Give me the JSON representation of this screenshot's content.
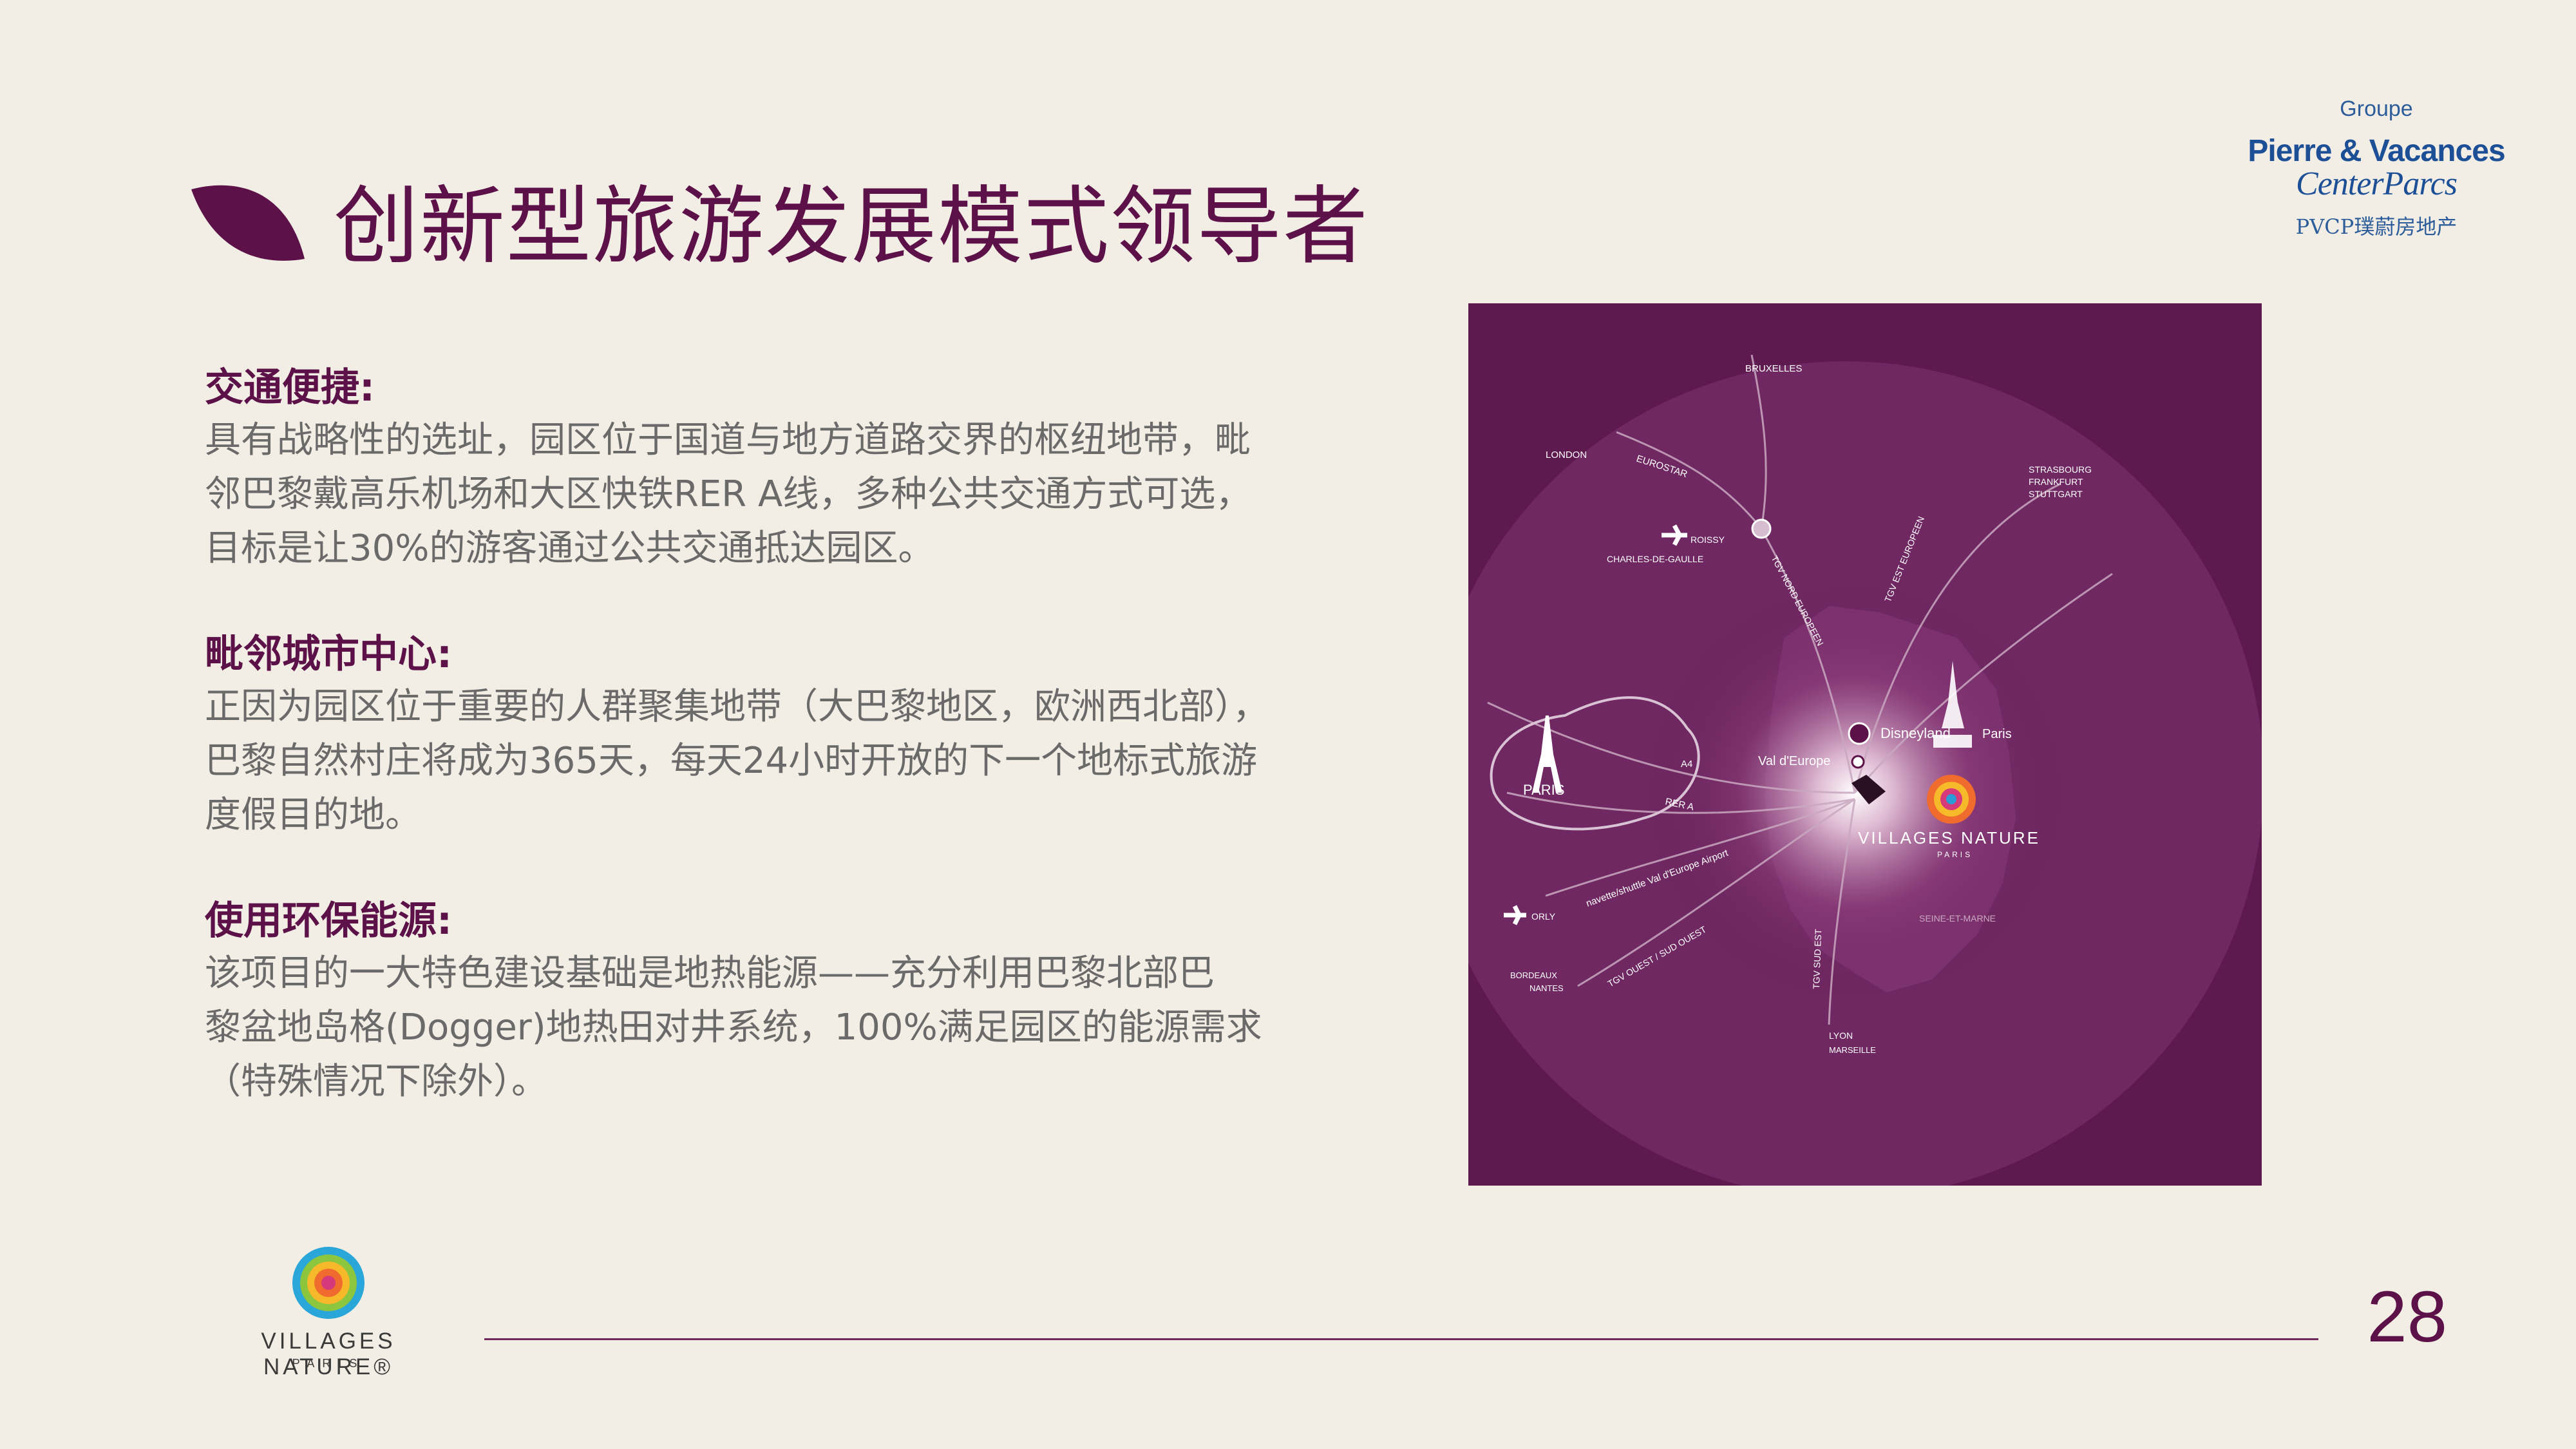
{
  "slide": {
    "title": "创新型旅游发展模式领导者",
    "page_number": "28"
  },
  "brand": {
    "groupe": "Groupe",
    "pierre_vacances": "Pierre & Vacances",
    "center_parcs": "CenterParcs",
    "chinese_name": "PVCP璞蔚房地产"
  },
  "sections": [
    {
      "heading": "交通便捷:",
      "lines": [
        "具有战略性的选址，园区位于国道与地方道路交界的枢纽地带，毗",
        "邻巴黎戴高乐机场和大区快铁RER  A线，多种公共交通方式可选，",
        "目标是让30%的游客通过公共交通抵达园区。"
      ]
    },
    {
      "heading": "毗邻城市中心:",
      "lines": [
        "正因为园区位于重要的人群聚集地带（大巴黎地区，欧洲西北部），",
        "巴黎自然村庄将成为365天，每天24小时开放的下一个地标式旅游",
        "度假目的地。"
      ]
    },
    {
      "heading": "使用环保能源:",
      "lines": [
        "该项目的一大特色建设基础是地热能源——充分利用巴黎北部巴",
        "黎盆地岛格(Dogger)地热田对井系统，100%满足园区的能源需求",
        "（特殊情况下除外）。"
      ]
    }
  ],
  "map": {
    "labels": {
      "bruxelles": "BRUXELLES",
      "london": "LONDON",
      "eurostar": "EUROSTAR",
      "strasbourg": "STRASBOURG",
      "frankfurt": "FRANKFURT",
      "stuttgart": "STUTTGART",
      "roissy": "ROISSY",
      "cdg": "CHARLES-DE-GAULLE",
      "tgv_nord": "TGV NORD EUROPEEN",
      "tgv_est": "TGV EST EUROPEEN",
      "disneyland": "Disneyland",
      "paris_suffix": "Paris",
      "val_europe": "Val d'Europe",
      "paris": "PARIS",
      "a4": "A4",
      "rer_a": "RER A",
      "villages_nature": "VILLAGES NATURE",
      "villages_nature_paris": "PARIS",
      "navette": "navette/shuttle Val d'Europe Airport",
      "orly": "ORLY",
      "bordeaux": "BORDEAUX",
      "nantes": "NANTES",
      "tgv_ouest": "TGV OUEST / SUD OUEST",
      "tgv_sud": "TGV SUD EST",
      "seine_et_marne": "SEINE-ET-MARNE",
      "lyon": "LYON",
      "marseille": "MARSEILLE"
    }
  },
  "footer_logo": {
    "name": "VILLAGES NATURE",
    "registered": "®",
    "city": "PARIS"
  },
  "colors": {
    "background": "#f3eee5",
    "accent": "#5c1148",
    "map_bg": "#5e1a4f",
    "body_text": "#6a6a6a",
    "brand_blue": "#1d4f96"
  }
}
